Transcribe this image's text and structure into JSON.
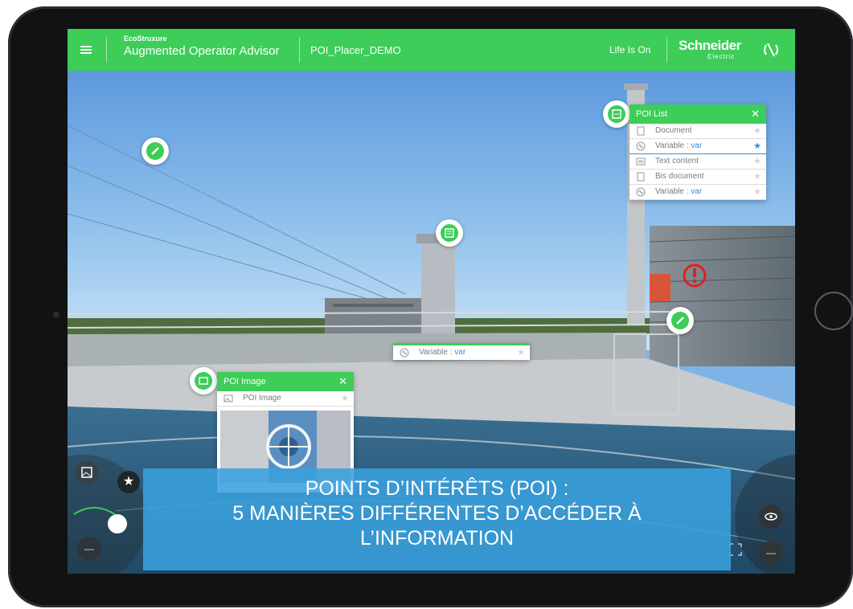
{
  "app": {
    "brand_small": "EcoStruxure",
    "title": "Augmented Operator Advisor",
    "project": "POI_Placer_DEMO",
    "tagline": "Life Is On",
    "company": "Schneider",
    "company_sub": "Electric",
    "accent_color": "#3dcd58"
  },
  "poi_list": {
    "title": "POI List",
    "close": "✕",
    "items": [
      {
        "icon": "document-icon",
        "label": "Document",
        "value": "",
        "starred": false
      },
      {
        "icon": "variable-icon",
        "label": "Variable : ",
        "value": "var",
        "starred": true
      },
      {
        "icon": "text-icon",
        "label": "Text content",
        "value": "",
        "starred": false
      },
      {
        "icon": "document-icon",
        "label": "Bis document",
        "value": "",
        "starred": false
      },
      {
        "icon": "variable-icon",
        "label": "Variable : ",
        "value": "var",
        "starred": false
      }
    ]
  },
  "variable_label": {
    "label": "Variable : ",
    "value": "var"
  },
  "poi_image": {
    "title": "POI Image",
    "close": "✕",
    "item_label": "POI Image"
  },
  "banner": {
    "line1": "POINTS D’INTÉRÊTS (POI) :",
    "line2": "5 MANIÈRES DIFFÉRENTES D’ACCÉDER À",
    "line3": "L’INFORMATION"
  },
  "icons": {
    "star": "★",
    "minus": "—",
    "star_color": "#2a8ee6",
    "alert_color": "#e02020"
  }
}
